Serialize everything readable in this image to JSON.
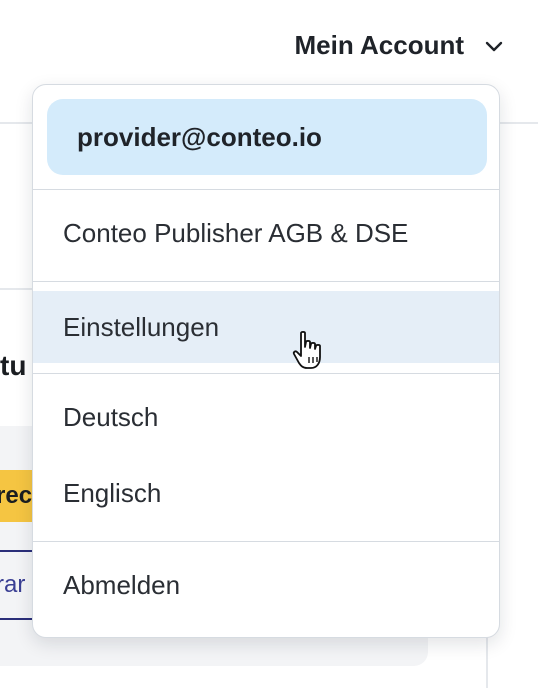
{
  "header": {
    "account_label": "Mein Account"
  },
  "background": {
    "heading_fragment": "tu",
    "badge_fragment": "rec",
    "link_fragment": "rar"
  },
  "dropdown": {
    "email": "provider@conteo.io",
    "items": [
      {
        "label": "Conteo Publisher AGB & DSE"
      },
      {
        "label": "Einstellungen"
      },
      {
        "label": "Deutsch"
      },
      {
        "label": "Englisch"
      },
      {
        "label": "Abmelden"
      }
    ]
  },
  "icons": {
    "account_toggle": "chevron-down-icon",
    "cursor": "hand-pointer-icon"
  },
  "colors": {
    "email_highlight": "#d4ebfb",
    "hover_row": "#e5eef7",
    "badge": "#f5c542",
    "link": "#3a3f94"
  }
}
